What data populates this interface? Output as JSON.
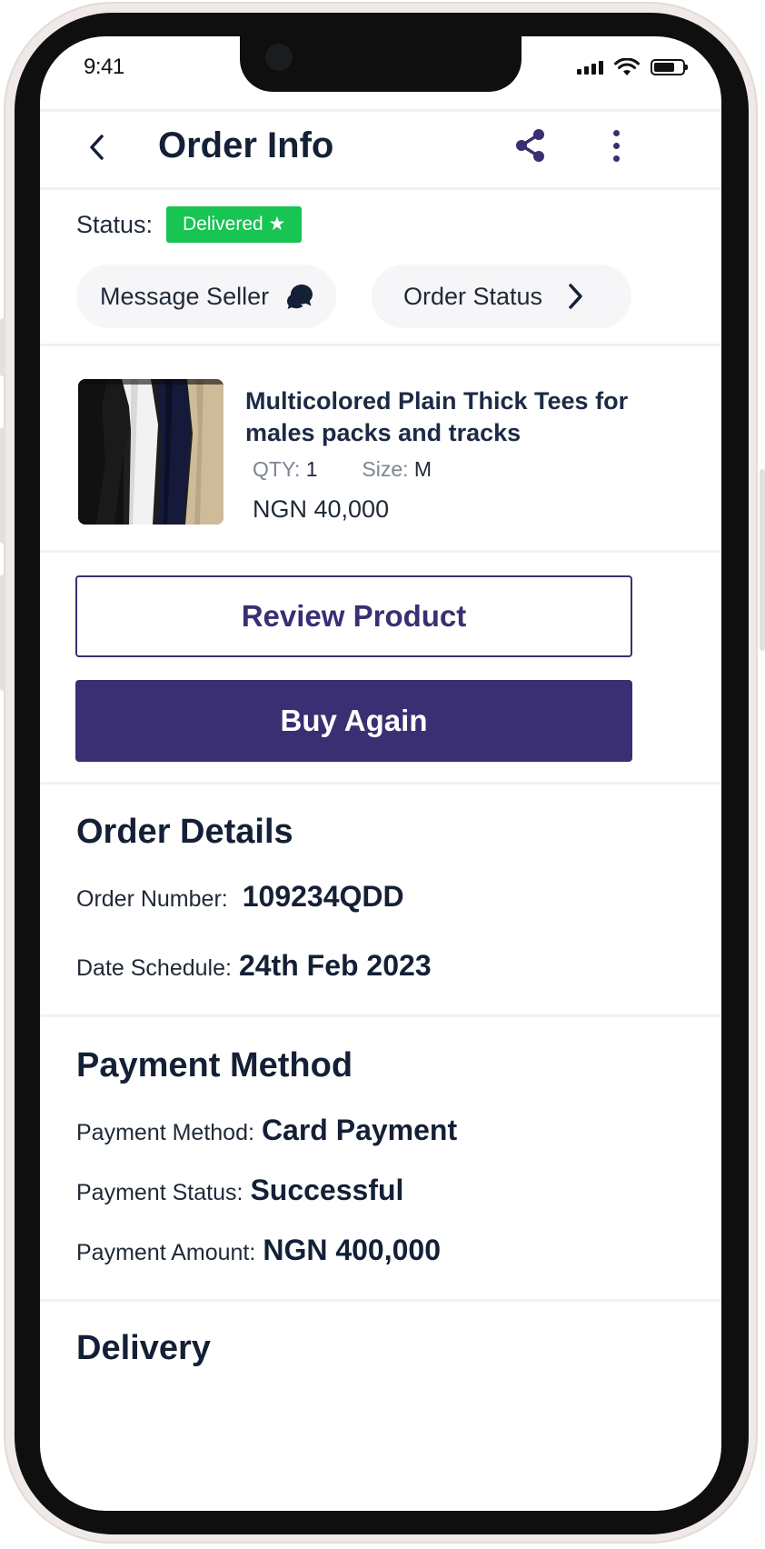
{
  "status_bar": {
    "time": "9:41"
  },
  "header": {
    "title": "Order Info",
    "back_icon": "chevron-left-icon",
    "share_icon": "share-icon",
    "more_icon": "more-vertical-icon"
  },
  "order_status": {
    "label": "Status:",
    "badge": "Delivered ★",
    "badge_color": "#18c452"
  },
  "actions": {
    "message_seller": "Message Seller",
    "order_status": "Order Status"
  },
  "product": {
    "name": "Multicolored Plain Thick Tees for males packs and tracks",
    "qty_label": "QTY:",
    "qty_value": "1",
    "size_label": "Size:",
    "size_value": "M",
    "price": "NGN 40,000"
  },
  "buttons": {
    "review": "Review Product",
    "buy_again": "Buy Again"
  },
  "order_details": {
    "title": "Order Details",
    "order_number_label": "Order Number:",
    "order_number_value": "109234QDD",
    "date_label": "Date Schedule:",
    "date_value": "24th Feb 2023"
  },
  "payment": {
    "title": "Payment Method",
    "method_label": "Payment Method:",
    "method_value": "Card Payment",
    "status_label": "Payment Status:",
    "status_value": "Successful",
    "amount_label": "Payment Amount:",
    "amount_value": "NGN 400,000"
  },
  "delivery": {
    "title": "Delivery"
  },
  "colors": {
    "primary": "#3a2f72",
    "success": "#18c452",
    "text_dark": "#142036"
  }
}
